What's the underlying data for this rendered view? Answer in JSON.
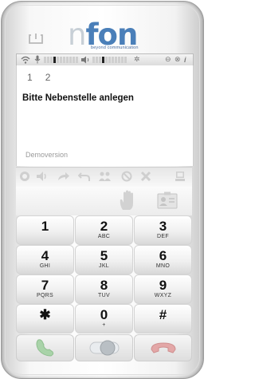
{
  "brand": {
    "name_part1": "n",
    "name_part2": "fon",
    "tagline": "beyond communication",
    "color": "#4a7fb9"
  },
  "status": {
    "mic_level": 0.25,
    "speaker_level": 0.3,
    "icons": [
      "wifi-icon",
      "mic-icon",
      "speaker-icon",
      "gear-icon",
      "minimize-icon",
      "close-icon",
      "info-icon"
    ]
  },
  "lines": [
    "1",
    "2"
  ],
  "message": "Bitte Nebenstelle anlegen",
  "status_text": "Demoversion",
  "toolbar": [
    "record-icon",
    "volume-icon",
    "forward-icon",
    "back-icon",
    "conference-icon",
    "block-icon",
    "cross-icon",
    "computer-icon"
  ],
  "keypad": [
    {
      "digit": "1",
      "letters": ""
    },
    {
      "digit": "2",
      "letters": "ABC"
    },
    {
      "digit": "3",
      "letters": "DEF"
    },
    {
      "digit": "4",
      "letters": "GHI"
    },
    {
      "digit": "5",
      "letters": "JKL"
    },
    {
      "digit": "6",
      "letters": "MNO"
    },
    {
      "digit": "7",
      "letters": "PQRS"
    },
    {
      "digit": "8",
      "letters": "TUV"
    },
    {
      "digit": "9",
      "letters": "WXYZ"
    },
    {
      "digit": "✱",
      "letters": ""
    },
    {
      "digit": "0",
      "letters": "+"
    },
    {
      "digit": "#",
      "letters": ""
    }
  ],
  "colors": {
    "call": "#7fbf7f",
    "hangup": "#d87a7a",
    "toggle": "#aab0b6"
  }
}
